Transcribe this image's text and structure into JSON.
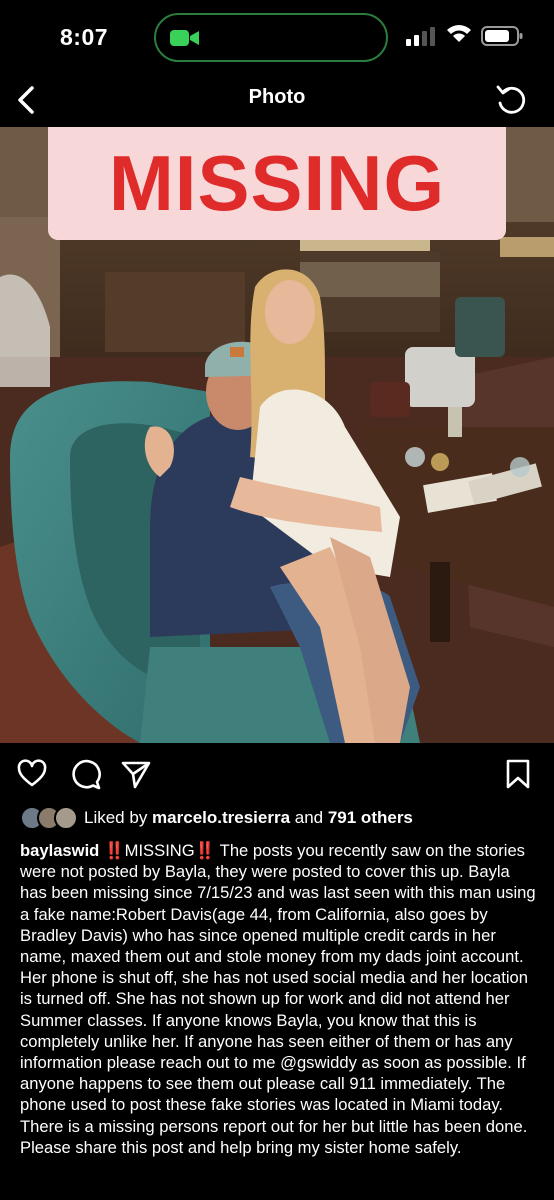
{
  "status_bar": {
    "time": "8:07"
  },
  "nav": {
    "title": "Photo"
  },
  "photo": {
    "banner_text": "MISSING"
  },
  "likes": {
    "prefix": "Liked by ",
    "user": "marcelo.tresierra",
    "middle": " and ",
    "count": "791 others"
  },
  "caption": {
    "username": "baylaswid",
    "bang_before": "‼️",
    "missing_word": "MISSING",
    "bang_after": "‼️",
    "body": " The posts you recently saw on the stories were not posted by Bayla, they were posted to cover this up. Bayla has been missing since 7/15/23 and was last seen with this man using a fake name:Robert Davis(age 44, from California, also goes by Bradley Davis) who has since opened multiple credit cards in her name, maxed them out and stole money from my dads joint account. Her phone is shut off, she has not used social media and her location is turned off. She has not shown up for work and did not attend her Summer classes. If anyone knows Bayla, you know that this is completely unlike her. If anyone has seen either of them or has any information please reach out to me @gswiddy as soon as possible. If anyone happens to see them out please call 911 immediately. The phone used to post these fake stories was located in Miami today. There is a missing persons report out for her but little has been done. Please share this post and help bring my sister home safely."
  },
  "icons": {
    "back": "chevron-left-icon",
    "refresh": "refresh-icon",
    "like": "heart-icon",
    "comment": "comment-icon",
    "share": "paper-plane-icon",
    "save": "bookmark-icon"
  },
  "colors": {
    "accent_red": "#e02b2b",
    "banner_bg": "#f8d7d9",
    "facetime_green": "#2a7d3e"
  }
}
